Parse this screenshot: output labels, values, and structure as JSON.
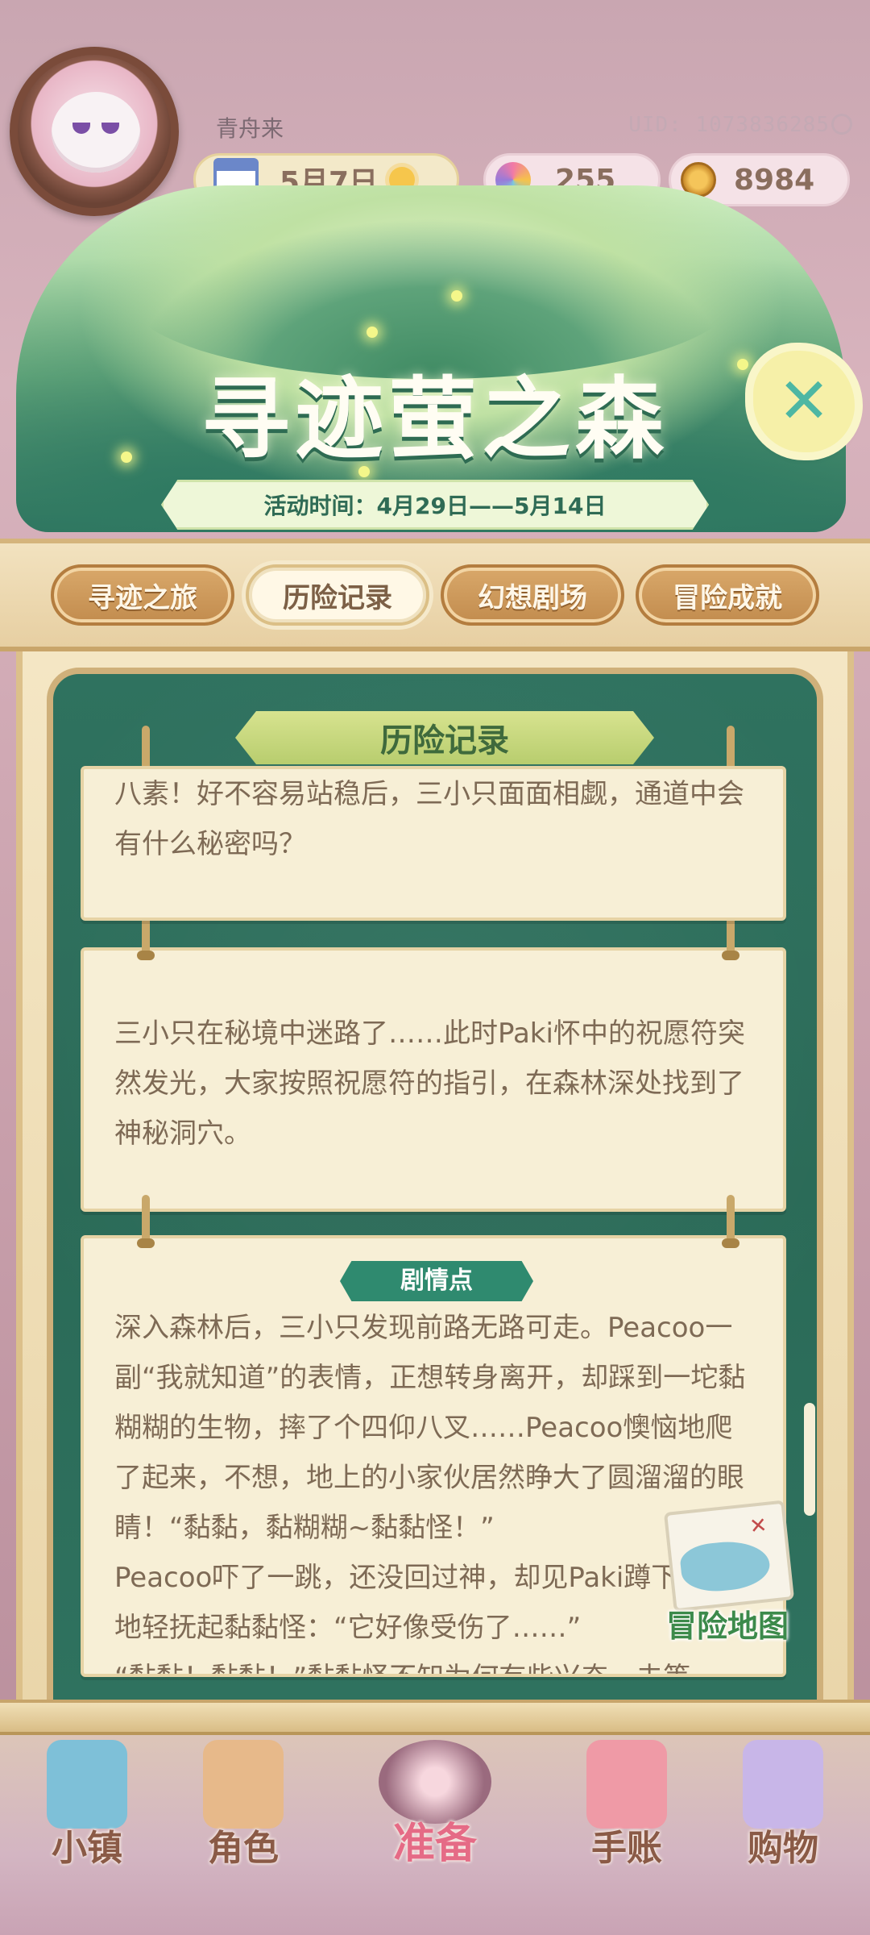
{
  "hud": {
    "player_name": "青舟来",
    "uid": "UID: 1073836285",
    "date": "5月7日",
    "gems": "255",
    "coins": "8984"
  },
  "event": {
    "title": "寻迹萤之森",
    "date_range": "活动时间：4月29日——5月14日"
  },
  "tabs": [
    {
      "label": "寻迹之旅",
      "active": false
    },
    {
      "label": "历险记录",
      "active": true
    },
    {
      "label": "幻想剧场",
      "active": false
    },
    {
      "label": "冒险成就",
      "active": false
    }
  ],
  "section_title": "历险记录",
  "cards": [
    {
      "text": "八素！好不容易站稳后，三小只面面相觑，通道中会有什么秘密吗？"
    },
    {
      "text": "三小只在秘境中迷路了……此时Paki怀中的祝愿符突然发光，大家按照祝愿符的指引，在森林深处找到了神秘洞穴。"
    },
    {
      "tag": "剧情点",
      "paragraphs": [
        "深入森林后，三小只发现前路无路可走。Peacoo一副“我就知道”的表情，正想转身离开，却踩到一坨黏糊糊的生物，摔了个四仰八叉……Peacoo懊恼地爬了起来，不想，地上的小家伙居然睁大了圆溜溜的眼睛！“黏黏，黏糊糊~黏黏怪！”",
        "Peacoo吓了一跳，还没回过神，却见Paki蹲下温柔地轻抚起黏黏怪：“它好像受伤了……”",
        "“黏黏！黏黏！”黏黏怪不知为何有些兴奋，未等"
      ]
    }
  ],
  "map_button_label": "冒险地图",
  "bottom_nav": [
    {
      "label": "小镇",
      "icon": "town-icon",
      "color": "#7ec0d8"
    },
    {
      "label": "角色",
      "icon": "character-icon",
      "color": "#e7b98a"
    },
    {
      "label": "准备",
      "icon": "prepare-icon",
      "color": "#f7d7de"
    },
    {
      "label": "手账",
      "icon": "journal-icon",
      "color": "#ef9aa6"
    },
    {
      "label": "购物",
      "icon": "shopping-bag-icon",
      "color": "#c8b6e8"
    }
  ],
  "colors": {
    "frame_green": "#2f725f",
    "parchment": "#f7efd6",
    "tab_brown": "#c28c4e",
    "accent_pink": "#e56b86"
  }
}
